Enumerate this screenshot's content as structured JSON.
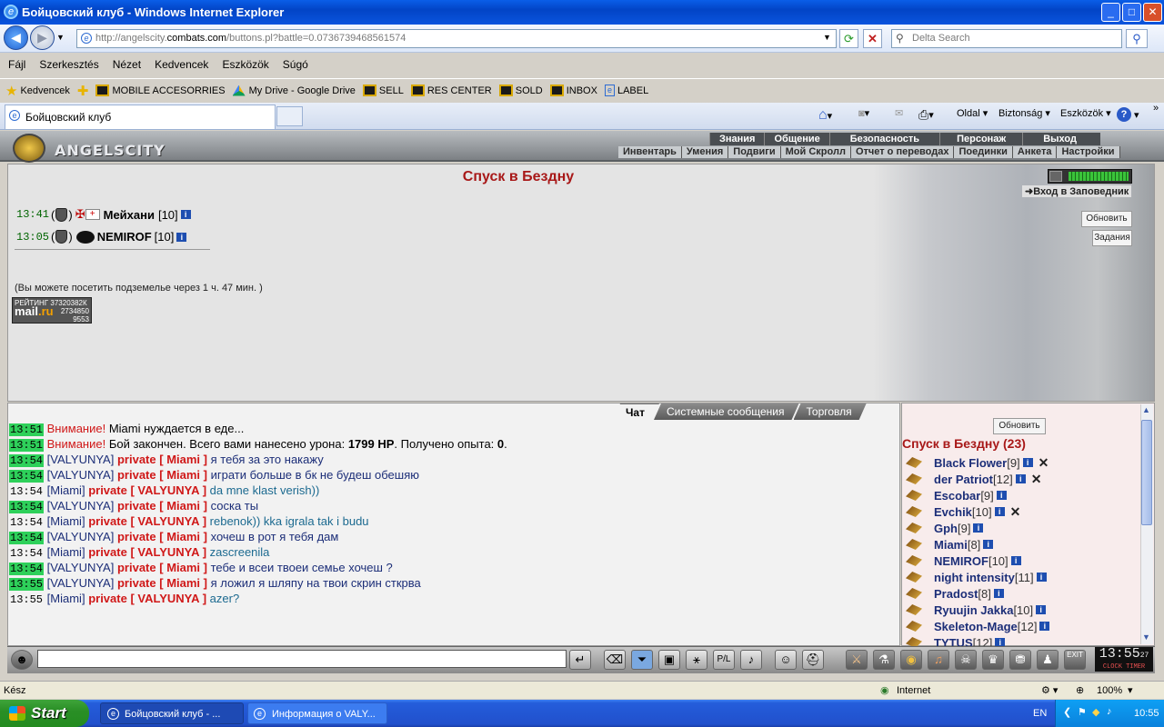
{
  "window": {
    "title": "Бойцовский клуб - Windows Internet Explorer",
    "btn_min": "_",
    "btn_max": "□",
    "btn_close": "✕"
  },
  "address": {
    "url_prefix": "http://angelscity.",
    "url_host": "combats.com",
    "url_rest": "/buttons.pl?battle=0.0736739468561574",
    "search_placeholder": "Delta Search"
  },
  "menu": [
    "Fájl",
    "Szerkesztés",
    "Nézet",
    "Kedvencek",
    "Eszközök",
    "Súgó"
  ],
  "favorites": {
    "label": "Kedvencek",
    "items": [
      "MOBILE ACCESORRIES",
      "My Drive - Google Drive",
      "SELL",
      "RES CENTER",
      "SOLD",
      "INBOX",
      "LABEL"
    ]
  },
  "ie_tab": {
    "title": "Бойцовский клуб"
  },
  "ie_toolbar": {
    "oldal": "Oldal",
    "biztonsag": "Biztonság",
    "eszkozok": "Eszközök",
    "help": "?"
  },
  "game": {
    "logo": "ANGELSCITY",
    "topnav": [
      "Знания",
      "Общение",
      "Безопасность",
      "Персонаж",
      "Выход"
    ],
    "subnav": [
      "Инвентарь",
      "Умения",
      "Подвиги",
      "Мой Скролл",
      "Отчет о переводах",
      "Поединки",
      "Анкета",
      "Настройки"
    ],
    "dungeon_title": "Спуск в Бездну",
    "group": [
      {
        "time": "13:41",
        "name": "Мейхани",
        "level": "[10]"
      },
      {
        "time": "13:05",
        "name": "NEMIROF",
        "level": "[10]"
      }
    ],
    "visit_note": "(Вы можете посетить подземелье через 1 ч. 47 мин. )",
    "enter_reserve": "Вход в Заповедник",
    "refresh": "Обновить",
    "tasks": "Задания",
    "mailru": {
      "l1": "РЕЙТИНГ 37320382К",
      "brand": "mail",
      "brand2": ".ru",
      "n1": "2734850",
      "n2": "9553"
    }
  },
  "chat": {
    "tabs": [
      "Чат",
      "Системные сообщения",
      "Торговля"
    ],
    "lines": [
      {
        "time": "13:51",
        "hl": true,
        "kind": "warn",
        "pre": "Внимание!",
        "text": " Miami нуждается в еде..."
      },
      {
        "time": "13:51",
        "hl": true,
        "kind": "warn",
        "pre": "Внимание!",
        "text": " Бой закончен. Всего вами нанесено урона: ",
        "b1": "1799 HP",
        "mid": ". Получено опыта: ",
        "b2": "0",
        "end": "."
      },
      {
        "time": "13:54",
        "hl": true,
        "kind": "priv",
        "nick": "VALYUNYA",
        "to": "Miami",
        "text": "я тебя за это накажу"
      },
      {
        "time": "13:54",
        "hl": true,
        "kind": "priv",
        "nick": "VALYUNYA",
        "to": "Miami",
        "text": "играти больше в бк не будеш обешяю"
      },
      {
        "time": "13:54",
        "hl": false,
        "kind": "priv",
        "nick": "Miami",
        "to": "VALYUNYA",
        "text": "da mne klast verish))"
      },
      {
        "time": "13:54",
        "hl": true,
        "kind": "priv",
        "nick": "VALYUNYA",
        "to": "Miami",
        "text": "соска ты"
      },
      {
        "time": "13:54",
        "hl": false,
        "kind": "priv",
        "nick": "Miami",
        "to": "VALYUNYA",
        "text": "rebenok)) kka igrala tak i budu"
      },
      {
        "time": "13:54",
        "hl": true,
        "kind": "priv",
        "nick": "VALYUNYA",
        "to": "Miami",
        "text": "хочеш в рот я тебя дам"
      },
      {
        "time": "13:54",
        "hl": false,
        "kind": "priv",
        "nick": "Miami",
        "to": "VALYUNYA",
        "text": "zascreenila"
      },
      {
        "time": "13:54",
        "hl": true,
        "kind": "priv",
        "nick": "VALYUNYA",
        "to": "Miami",
        "text": "тебе и всеи твоеи семье хочеш ?"
      },
      {
        "time": "13:55",
        "hl": true,
        "kind": "priv",
        "nick": "VALYUNYA",
        "to": "Miami",
        "text": "я ложил я шляпу на твои скрин сткрва"
      },
      {
        "time": "13:55",
        "hl": false,
        "kind": "priv",
        "nick": "Miami",
        "to": "VALYUNYA",
        "text": "azer?"
      }
    ],
    "private_label": "private"
  },
  "players": {
    "refresh": "Обновить",
    "title": "Спуск в Бездну (23)",
    "list": [
      {
        "name": "Black Flower",
        "level": "[9]",
        "x": true
      },
      {
        "name": "der Patriot",
        "level": "[12]",
        "x": true
      },
      {
        "name": "Escobar",
        "level": "[9]",
        "x": false
      },
      {
        "name": "Evchik",
        "level": "[10]",
        "x": true
      },
      {
        "name": "Gph",
        "level": "[9]",
        "x": false
      },
      {
        "name": "Miami",
        "level": "[8]",
        "x": false
      },
      {
        "name": "NEMIROF",
        "level": "[10]",
        "x": false
      },
      {
        "name": "night intensity",
        "level": "[11]",
        "x": false
      },
      {
        "name": "Pradost",
        "level": "[8]",
        "x": false
      },
      {
        "name": "Ryuujin Jakka",
        "level": "[10]",
        "x": false
      },
      {
        "name": "Skeleton-Mage",
        "level": "[12]",
        "x": false
      },
      {
        "name": "TYTUS",
        "level": "[12]",
        "x": false
      }
    ]
  },
  "clock": {
    "time": "13:55",
    "sec": "27",
    "label": "CLOCK  TIMER",
    "exit": "EXIT"
  },
  "status": {
    "left": "Kész",
    "zone": "Internet",
    "zoom": "100%"
  },
  "taskbar": {
    "start": "Start",
    "tasks": [
      "Бойцовский клуб - ...",
      "Информация о VALY..."
    ],
    "lang": "EN",
    "time": "10:55"
  }
}
